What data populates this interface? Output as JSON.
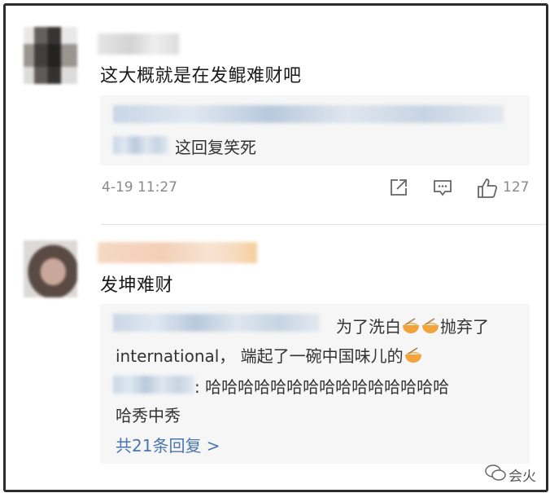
{
  "comments": [
    {
      "text": "这大概就是在发鲲难财吧",
      "reply_preview": "这回复笑死",
      "time": "4-19 11:27",
      "likes": "127"
    },
    {
      "text": "发坤难财",
      "reply1_text_a": "为了洗白",
      "reply1_text_b": "抛弃了",
      "reply1_line2": "international， 端起了一碗中国味儿的",
      "reply2_line1": ": 哈哈哈哈哈哈哈哈哈哈哈哈哈哈哈",
      "reply2_line2": "哈秀中秀",
      "more_replies": "共21条回复 >"
    }
  ],
  "watermark": "会火",
  "icons": [
    "share-icon",
    "comment-icon",
    "like-icon",
    "noodle-bowl-emoji",
    "wechat-brand-icon"
  ],
  "colors": {
    "link": "#4a75b0",
    "meta": "#8a8a8a",
    "reply_bg": "#f6f6f6"
  }
}
